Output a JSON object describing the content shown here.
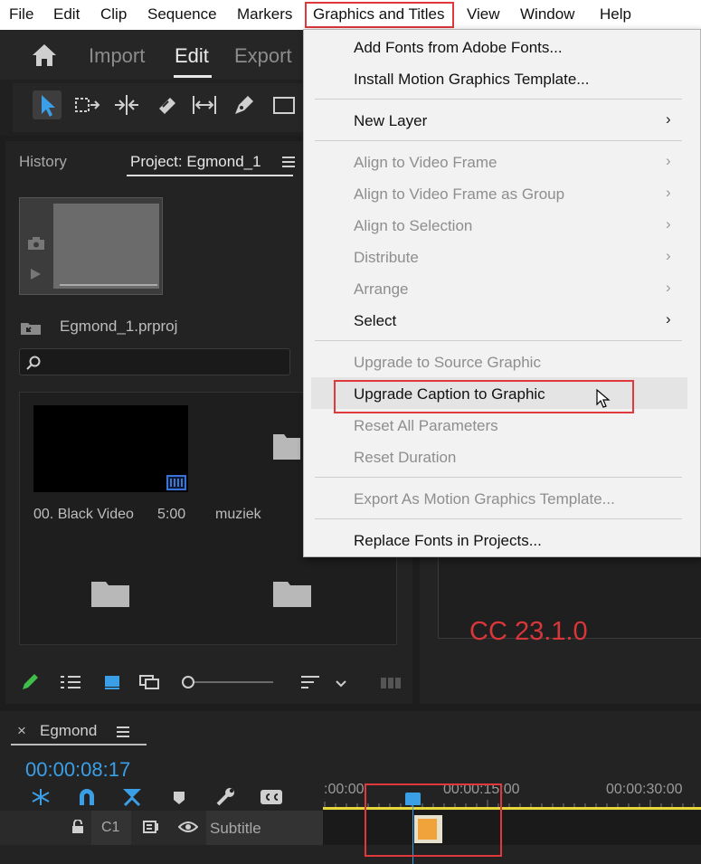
{
  "menubar": {
    "items": [
      "File",
      "Edit",
      "Clip",
      "Sequence",
      "Markers",
      "Graphics and Titles",
      "View",
      "Window",
      "Help"
    ]
  },
  "workspaces": {
    "import": "Import",
    "edit": "Edit",
    "export": "Export"
  },
  "project_panel": {
    "history_tab": "History",
    "project_tab": "Project: Egmond_1",
    "project_file": "Egmond_1.prproj",
    "items": [
      {
        "name": "00. Black Video",
        "duration": "5:00"
      },
      {
        "name": "muziek"
      }
    ]
  },
  "dropdown": {
    "items": [
      {
        "label": "Add Fonts from Adobe Fonts...",
        "enabled": true
      },
      {
        "label": "Install Motion Graphics Template...",
        "enabled": true
      },
      {
        "label": "New Layer",
        "enabled": true,
        "submenu": true
      },
      {
        "label": "Align to Video Frame",
        "enabled": false,
        "submenu": true
      },
      {
        "label": "Align to Video Frame as Group",
        "enabled": false,
        "submenu": true
      },
      {
        "label": "Align to Selection",
        "enabled": false,
        "submenu": true
      },
      {
        "label": "Distribute",
        "enabled": false,
        "submenu": true
      },
      {
        "label": "Arrange",
        "enabled": false,
        "submenu": true
      },
      {
        "label": "Select",
        "enabled": true,
        "submenu": true
      },
      {
        "label": "Upgrade to Source Graphic",
        "enabled": false
      },
      {
        "label": "Upgrade Caption to Graphic",
        "enabled": true
      },
      {
        "label": "Reset All Parameters",
        "enabled": false
      },
      {
        "label": "Reset Duration",
        "enabled": false
      },
      {
        "label": "Export As Motion Graphics Template...",
        "enabled": false
      },
      {
        "label": "Replace Fonts in Projects...",
        "enabled": true
      }
    ],
    "submenu_glyph": "›"
  },
  "version_annotation": "CC 23.1.0",
  "timeline": {
    "close_glyph": "×",
    "sequence_name": "Egmond",
    "timecode": "00:00:08:17",
    "ruler_labels": [
      ":00:00",
      "00:00:15:00",
      "00:00:30:00"
    ],
    "track_target": "C1",
    "track_name": "Subtitle"
  },
  "colors": {
    "accent_blue": "#3b9fe8",
    "annotation_red": "#e0393d",
    "caption_clip": "#f0a33a",
    "timeline_yellow": "#e6d73a"
  },
  "icons": [
    "home-icon",
    "selection-tool-icon",
    "track-select-icon",
    "ripple-edit-icon",
    "razor-icon",
    "slip-icon",
    "pen-icon",
    "rectangle-icon",
    "camera-icon",
    "play-icon",
    "search-icon",
    "film-icon",
    "folder-icon",
    "pencil-icon",
    "list-view-icon",
    "icon-view-icon",
    "freeform-view-icon",
    "zoom-slider-icon",
    "sort-icon",
    "chevron-down-icon",
    "automate-icon",
    "hamburger-icon",
    "snap-icon",
    "linked-selection-icon",
    "marker-icon",
    "wrench-icon",
    "captions-icon",
    "lock-icon",
    "sync-icon",
    "eye-icon",
    "mouse-cursor-icon"
  ]
}
